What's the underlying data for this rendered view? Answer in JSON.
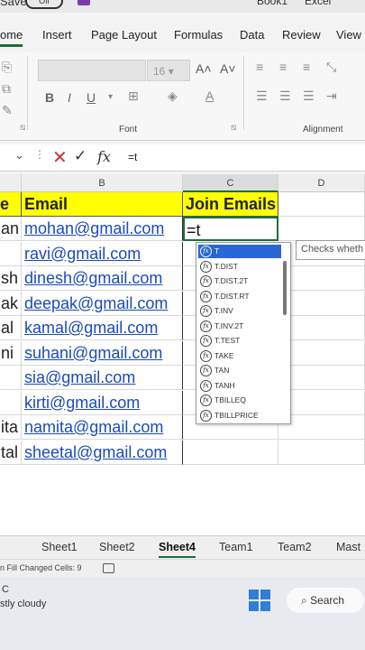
{
  "titlebar": {
    "save_label": "Save",
    "toggle_label": "Off",
    "right1": "Book1",
    "right2": "Excel"
  },
  "tabs": [
    "ome",
    "Insert",
    "Page Layout",
    "Formulas",
    "Data",
    "Review",
    "View"
  ],
  "ribbon": {
    "font_size": "16",
    "font_group_label": "Font",
    "alignment_group_label": "Alignment"
  },
  "formula_bar": {
    "formula": "=t"
  },
  "columns": [
    "B",
    "C",
    "D"
  ],
  "headers": {
    "name_partial": "e",
    "email": "Email",
    "join": "Join Emails"
  },
  "rows": [
    {
      "name": "an",
      "email": "mohan@gmail.com",
      "join": "=t"
    },
    {
      "name": "",
      "email": "ravi@gmail.com",
      "join": ""
    },
    {
      "name": "sh",
      "email": "dinesh@gmail.com",
      "join": ""
    },
    {
      "name": "ak",
      "email": "deepak@gmail.com",
      "join": ""
    },
    {
      "name": "al",
      "email": "kamal@gmail.com",
      "join": ""
    },
    {
      "name": "ni",
      "email": "suhani@gmail.com",
      "join": ""
    },
    {
      "name": "",
      "email": "sia@gmail.com",
      "join": ""
    },
    {
      "name": "",
      "email": "kirti@gmail.com",
      "join": ""
    },
    {
      "name": "ita",
      "email": "namita@gmail.com",
      "join": ""
    },
    {
      "name": "tal",
      "email": "sheetal@gmail.com",
      "join": ""
    }
  ],
  "autocomplete": {
    "items": [
      "T",
      "T.DIST",
      "T.DIST.2T",
      "T.DIST.RT",
      "T.INV",
      "T.INV.2T",
      "T.TEST",
      "TAKE",
      "TAN",
      "TANH",
      "TBILLEQ",
      "TBILLPRICE"
    ],
    "highlight_color": "#2a66d6",
    "tooltip": "Checks wheth"
  },
  "sheets": [
    "Sheet1",
    "Sheet2",
    "Sheet4",
    "Team1",
    "Team2",
    "Mast"
  ],
  "status": {
    "text": "n Fill Changed Cells: 9"
  },
  "taskbar": {
    "weather1": "C",
    "weather2": "stly cloudy",
    "search_label": "Search"
  },
  "colors": {
    "header_fill": "#ffff00",
    "link": "#1a4bb8",
    "excel_green": "#1b6e3c"
  }
}
